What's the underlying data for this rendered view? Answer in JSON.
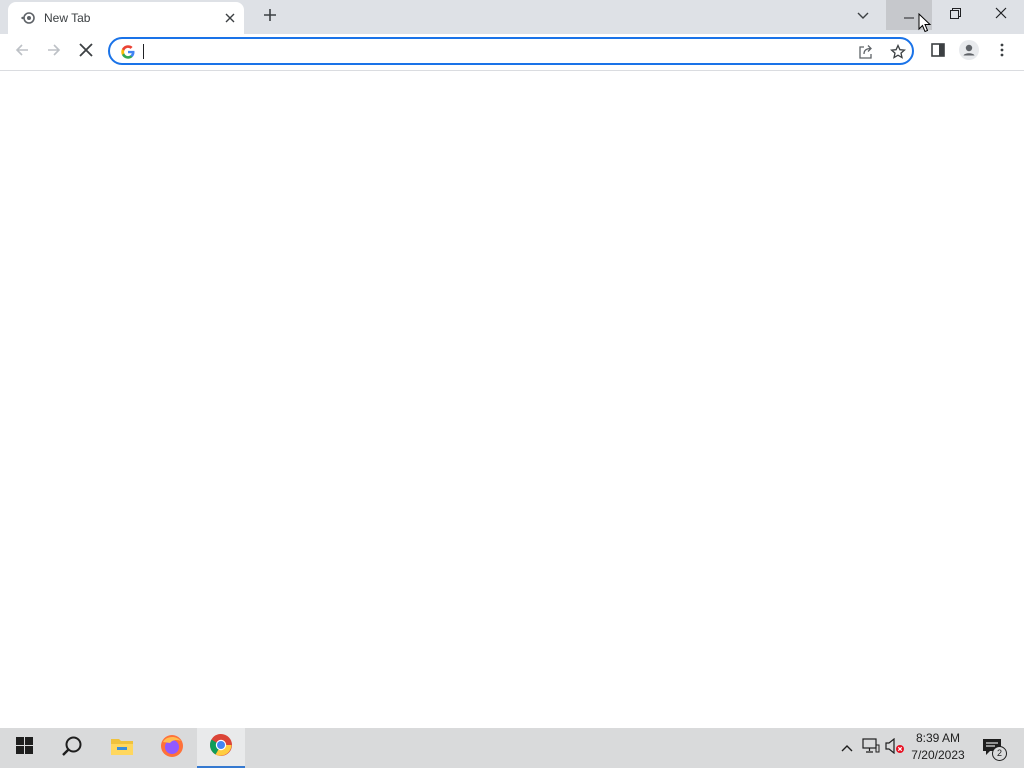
{
  "browser": {
    "tab": {
      "title": "New Tab",
      "favicon": "chrome-newtab-icon",
      "close_icon": "close-icon"
    },
    "new_tab_icon": "plus-icon",
    "tab_search_icon": "chevron-down-icon",
    "window_controls": [
      "minimize-icon",
      "restore-icon",
      "close-icon"
    ],
    "toolbar": {
      "back_icon": "arrow-left-icon",
      "forward_icon": "arrow-right-icon",
      "stop_icon": "stop-icon",
      "omnibox": {
        "value": "",
        "search_engine_icon": "google-icon"
      },
      "share_icon": "share-icon",
      "bookmark_icon": "star-icon",
      "side_panel_icon": "side-panel-icon",
      "profile_icon": "avatar-icon",
      "menu_icon": "kebab-menu-icon"
    }
  },
  "taskbar": {
    "pinned": [
      "windows-start-icon",
      "search-icon",
      "file-explorer-icon",
      "firefox-icon",
      "chrome-icon"
    ],
    "active": "chrome-icon",
    "tray_icons": [
      "chevron-up-icon",
      "network-icon",
      "volume-muted-icon"
    ],
    "time": "8:39 AM",
    "date": "7/20/2023",
    "notification_count": "2"
  },
  "colors": {
    "tabstrip_bg": "#dee1e6",
    "accent_blue": "#1a73e8",
    "taskbar_bg": "#d9dadb"
  }
}
